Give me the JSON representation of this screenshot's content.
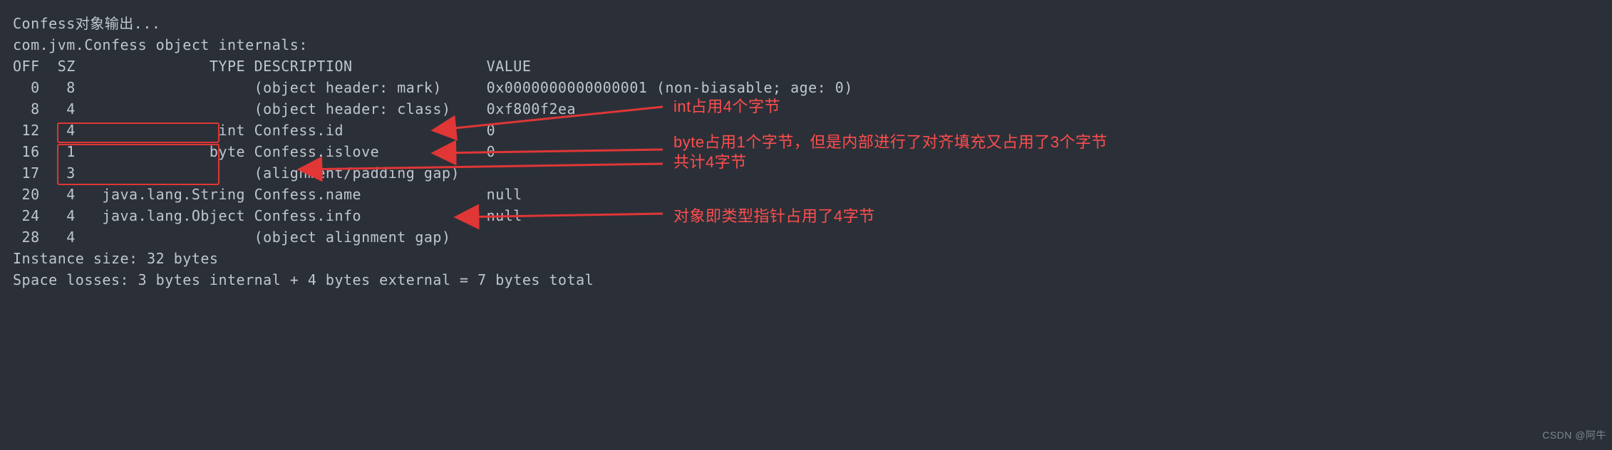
{
  "output_header": "Confess对象输出...",
  "class_line": "com.jvm.Confess object internals:",
  "cols": "OFF  SZ               TYPE DESCRIPTION               VALUE",
  "rows": [
    "  0   8                    (object header: mark)     0x0000000000000001 (non-biasable; age: 0)",
    "  8   4                    (object header: class)    0xf800f2ea",
    " 12   4                int Confess.id                0",
    " 16   1               byte Confess.islove            0",
    " 17   3                    (alignment/padding gap)   ",
    " 20   4   java.lang.String Confess.name              null",
    " 24   4   java.lang.Object Confess.info              null",
    " 28   4                    (object alignment gap)    "
  ],
  "instance_size": "Instance size: 32 bytes",
  "space_losses": "Space losses: 3 bytes internal + 4 bytes external = 7 bytes total",
  "annotations": {
    "a1": "int占用4个字节",
    "a2_l1": "byte占用1个字节，但是内部进行了对齐填充又占用了3个字节",
    "a2_l2": "共计4字节",
    "a3": "对象即类型指针占用了4字节"
  },
  "chart_data": {
    "type": "table",
    "title": "com.jvm.Confess object internals",
    "columns": [
      "OFF",
      "SZ",
      "TYPE",
      "DESCRIPTION",
      "VALUE"
    ],
    "rows": [
      {
        "OFF": 0,
        "SZ": 8,
        "TYPE": "",
        "DESCRIPTION": "(object header: mark)",
        "VALUE": "0x0000000000000001 (non-biasable; age: 0)"
      },
      {
        "OFF": 8,
        "SZ": 4,
        "TYPE": "",
        "DESCRIPTION": "(object header: class)",
        "VALUE": "0xf800f2ea"
      },
      {
        "OFF": 12,
        "SZ": 4,
        "TYPE": "int",
        "DESCRIPTION": "Confess.id",
        "VALUE": "0"
      },
      {
        "OFF": 16,
        "SZ": 1,
        "TYPE": "byte",
        "DESCRIPTION": "Confess.islove",
        "VALUE": "0"
      },
      {
        "OFF": 17,
        "SZ": 3,
        "TYPE": "",
        "DESCRIPTION": "(alignment/padding gap)",
        "VALUE": ""
      },
      {
        "OFF": 20,
        "SZ": 4,
        "TYPE": "java.lang.String",
        "DESCRIPTION": "Confess.name",
        "VALUE": "null"
      },
      {
        "OFF": 24,
        "SZ": 4,
        "TYPE": "java.lang.Object",
        "DESCRIPTION": "Confess.info",
        "VALUE": "null"
      },
      {
        "OFF": 28,
        "SZ": 4,
        "TYPE": "",
        "DESCRIPTION": "(object alignment gap)",
        "VALUE": ""
      }
    ],
    "instance_size_bytes": 32,
    "space_losses": {
      "internal_bytes": 3,
      "external_bytes": 4,
      "total_bytes": 7
    },
    "callouts": [
      {
        "target_off": 12,
        "text": "int占用4个字节",
        "meaning": "int uses 4 bytes"
      },
      {
        "target_off": [
          16,
          17
        ],
        "text": "byte占用1个字节，但是内部进行了对齐填充又占用了3个字节 共计4字节",
        "meaning": "byte uses 1 byte but 3 bytes of alignment padding are added internally, total 4 bytes"
      },
      {
        "target_off": 24,
        "text": "对象即类型指针占用了4字节",
        "meaning": "object (class-type pointer) uses 4 bytes"
      }
    ]
  },
  "watermark": "CSDN @阿牛"
}
